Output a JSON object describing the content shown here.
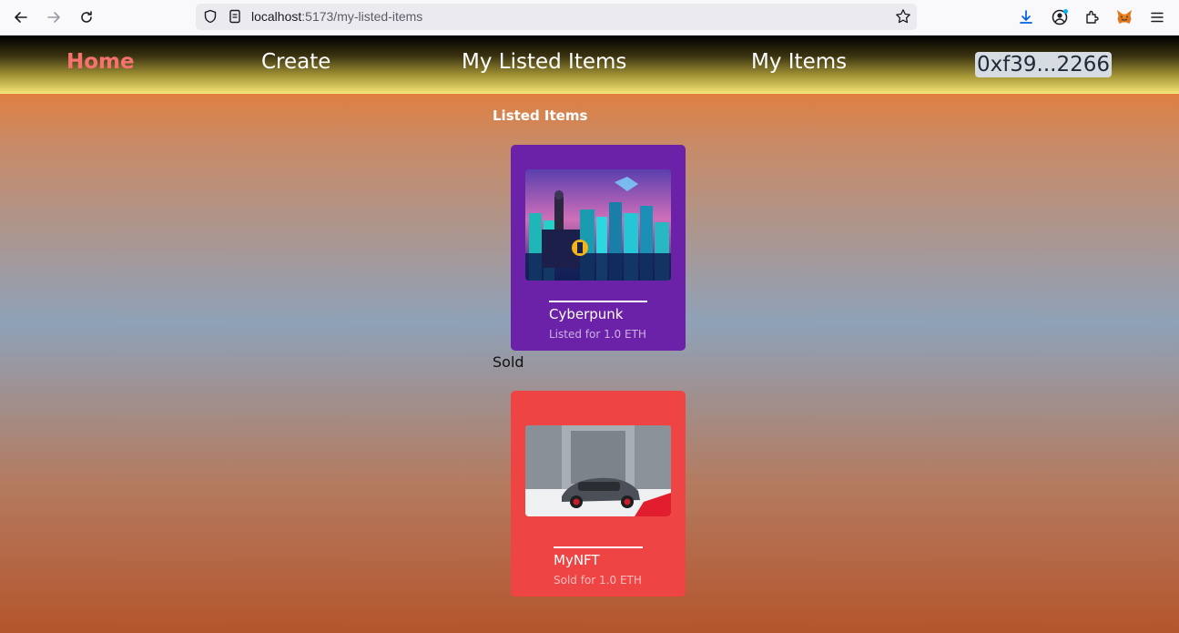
{
  "browser": {
    "url_host": "localhost",
    "url_path": ":5173/my-listed-items"
  },
  "nav": {
    "home": "Home",
    "create": "Create",
    "my_listed_items": "My Listed Items",
    "my_items": "My Items",
    "wallet": "0xf39...2266"
  },
  "main": {
    "listed_title": "Listed Items",
    "sold_title": "Sold"
  },
  "listed_items": [
    {
      "name": "Cyberpunk",
      "price": "Listed for 1.0 ETH"
    }
  ],
  "sold_items": [
    {
      "name": "MyNFT",
      "price": "Sold for 1.0 ETH"
    }
  ],
  "colors": {
    "accent_active": "#f87171",
    "listed_card": "#6b21a8",
    "sold_card": "#ef4444"
  }
}
